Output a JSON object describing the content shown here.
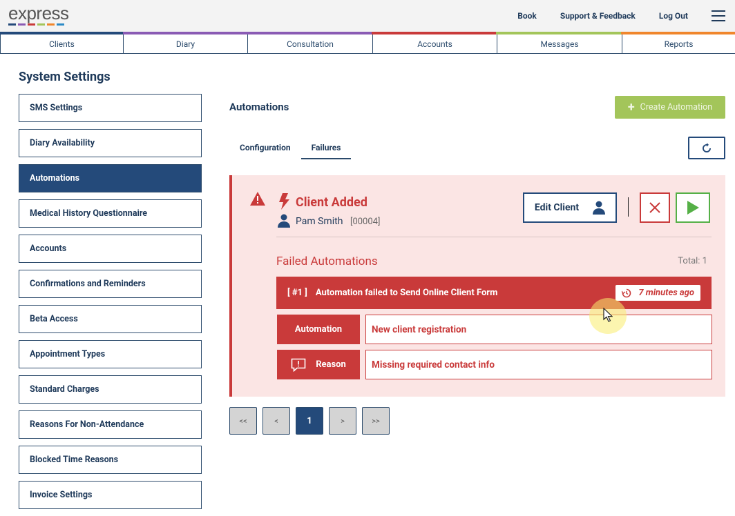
{
  "header": {
    "logo": "express",
    "logo_colors": [
      "#244a7a",
      "#8a5bb4",
      "#c93a3a",
      "#a3c55a",
      "#f0862c",
      "#2b8ac6"
    ],
    "links": [
      "Book",
      "Support & Feedback",
      "Log Out"
    ],
    "menu_icon": "hamburger-icon"
  },
  "nav": {
    "items": [
      "Clients",
      "Diary",
      "Consultation",
      "Accounts",
      "Messages",
      "Reports"
    ],
    "colors": [
      "#244a7a",
      "#8a5bb4",
      "#8a5bb4",
      "#c93a3a",
      "#a3c55a",
      "#f0862c"
    ]
  },
  "sidebar": {
    "title": "System Settings",
    "items": [
      "SMS Settings",
      "Diary Availability",
      "Automations",
      "Medical History Questionnaire",
      "Accounts",
      "Confirmations and Reminders",
      "Beta Access",
      "Appointment Types",
      "Standard Charges",
      "Reasons For Non-Attendance",
      "Blocked Time Reasons",
      "Invoice Settings"
    ],
    "active": "Automations"
  },
  "main": {
    "title": "Automations",
    "create_label": "Create Automation",
    "tabs": [
      "Configuration",
      "Failures"
    ],
    "active_tab": "Failures"
  },
  "failure": {
    "event": "Client Added",
    "client_name": "Pam Smith",
    "client_id": "[00004]",
    "edit_label": "Edit Client",
    "section_title": "Failed Automations",
    "total": "Total: 1",
    "entry_number": "[ #1 ]",
    "entry_message": "Automation failed to Send Online Client Form",
    "time_ago": "7 minutes ago",
    "automation_label": "Automation",
    "automation_value": "New client registration",
    "reason_label": "Reason",
    "reason_value": "Missing required contact info"
  },
  "pagination": {
    "first": "<<",
    "prev": "<",
    "current": "1",
    "next": ">",
    "last": ">>"
  }
}
